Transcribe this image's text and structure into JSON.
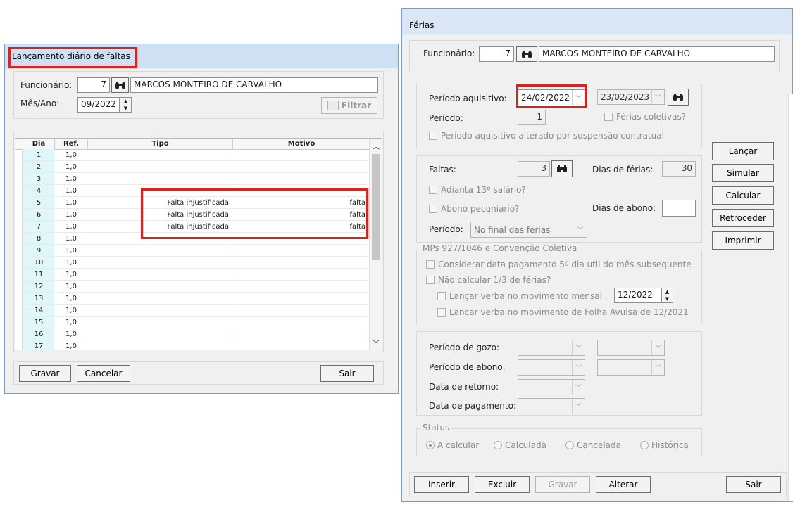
{
  "faltas": {
    "title": "Lançamento diário de faltas",
    "func_label": "Funcionário:",
    "func_code": "7",
    "func_name": "MARCOS MONTEIRO DE CARVALHO",
    "mes_label": "Mês/Ano:",
    "mes_value": "09/2022",
    "filtrar_label": "Filtrar",
    "columns": [
      "Dia",
      "Ref.",
      "Tipo",
      "Motivo"
    ],
    "rows": [
      {
        "dia": "1",
        "ref": "1,0",
        "tipo": "",
        "motivo": ""
      },
      {
        "dia": "2",
        "ref": "1,0",
        "tipo": "",
        "motivo": ""
      },
      {
        "dia": "3",
        "ref": "1,0",
        "tipo": "",
        "motivo": ""
      },
      {
        "dia": "4",
        "ref": "1,0",
        "tipo": "",
        "motivo": ""
      },
      {
        "dia": "5",
        "ref": "1,0",
        "tipo": "Falta injustificada",
        "motivo": "falta"
      },
      {
        "dia": "6",
        "ref": "1,0",
        "tipo": "Falta injustificada",
        "motivo": "falta"
      },
      {
        "dia": "7",
        "ref": "1,0",
        "tipo": "Falta injustificada",
        "motivo": "falta"
      },
      {
        "dia": "8",
        "ref": "1,0",
        "tipo": "",
        "motivo": ""
      },
      {
        "dia": "9",
        "ref": "1,0",
        "tipo": "",
        "motivo": ""
      },
      {
        "dia": "10",
        "ref": "1,0",
        "tipo": "",
        "motivo": ""
      },
      {
        "dia": "11",
        "ref": "1,0",
        "tipo": "",
        "motivo": ""
      },
      {
        "dia": "12",
        "ref": "1,0",
        "tipo": "",
        "motivo": ""
      },
      {
        "dia": "13",
        "ref": "1,0",
        "tipo": "",
        "motivo": ""
      },
      {
        "dia": "14",
        "ref": "1,0",
        "tipo": "",
        "motivo": ""
      },
      {
        "dia": "15",
        "ref": "1,0",
        "tipo": "",
        "motivo": ""
      },
      {
        "dia": "16",
        "ref": "1,0",
        "tipo": "",
        "motivo": ""
      },
      {
        "dia": "17",
        "ref": "1,0",
        "tipo": "",
        "motivo": ""
      }
    ],
    "buttons": {
      "gravar": "Gravar",
      "cancelar": "Cancelar",
      "sair": "Sair"
    }
  },
  "ferias": {
    "title": "Férias",
    "func_label": "Funcionário:",
    "func_code": "7",
    "func_name": "MARCOS MONTEIRO DE CARVALHO",
    "periodo_aq_label": "Período aquisitivo:",
    "periodo_aq_start": "24/02/2022",
    "periodo_aq_end": "23/02/2023",
    "periodo_label": "Período:",
    "periodo_value": "1",
    "ferias_coletivas": "Férias coletivas?",
    "periodo_alterado": "Período aquisitivo alterado por suspensão contratual",
    "faltas_label": "Faltas:",
    "faltas_value": "3",
    "dias_ferias_label": "Dias de férias:",
    "dias_ferias_value": "30",
    "adianta": "Adianta 13º salário?",
    "abono": "Abono pecuniário?",
    "dias_abono_label": "Dias de abono:",
    "dias_abono_value": "",
    "periodo2_label": "Período:",
    "periodo2_value": "No final das férias",
    "mps_group": "MPs 927/1046 e Convenção Coletiva",
    "considerar": "Considerar data pagamento 5º dia util do mês subsequente",
    "nao_calcular": "Não calcular 1/3 de férias?",
    "lancar_mensal": "Lançar verba  no movimento mensal :",
    "lancar_mensal_value": "12/2022",
    "lancar_avulsa": "Lancar verba no movimento de Folha Avulsa de 12/2021",
    "periodo_gozo": "Período de gozo:",
    "periodo_abono": "Período de abono:",
    "data_retorno": "Data de retorno:",
    "data_pagamento": "Data de pagamento:",
    "status_group": "Status",
    "status": [
      "A calcular",
      "Calculada",
      "Cancelada",
      "Histórica"
    ],
    "side_buttons": [
      "Lançar",
      "Simular",
      "Calcular",
      "Retroceder",
      "Imprimir"
    ],
    "bottom_buttons": {
      "inserir": "Inserir",
      "excluir": "Excluir",
      "gravar": "Gravar",
      "alterar": "Alterar",
      "sair": "Sair"
    }
  }
}
